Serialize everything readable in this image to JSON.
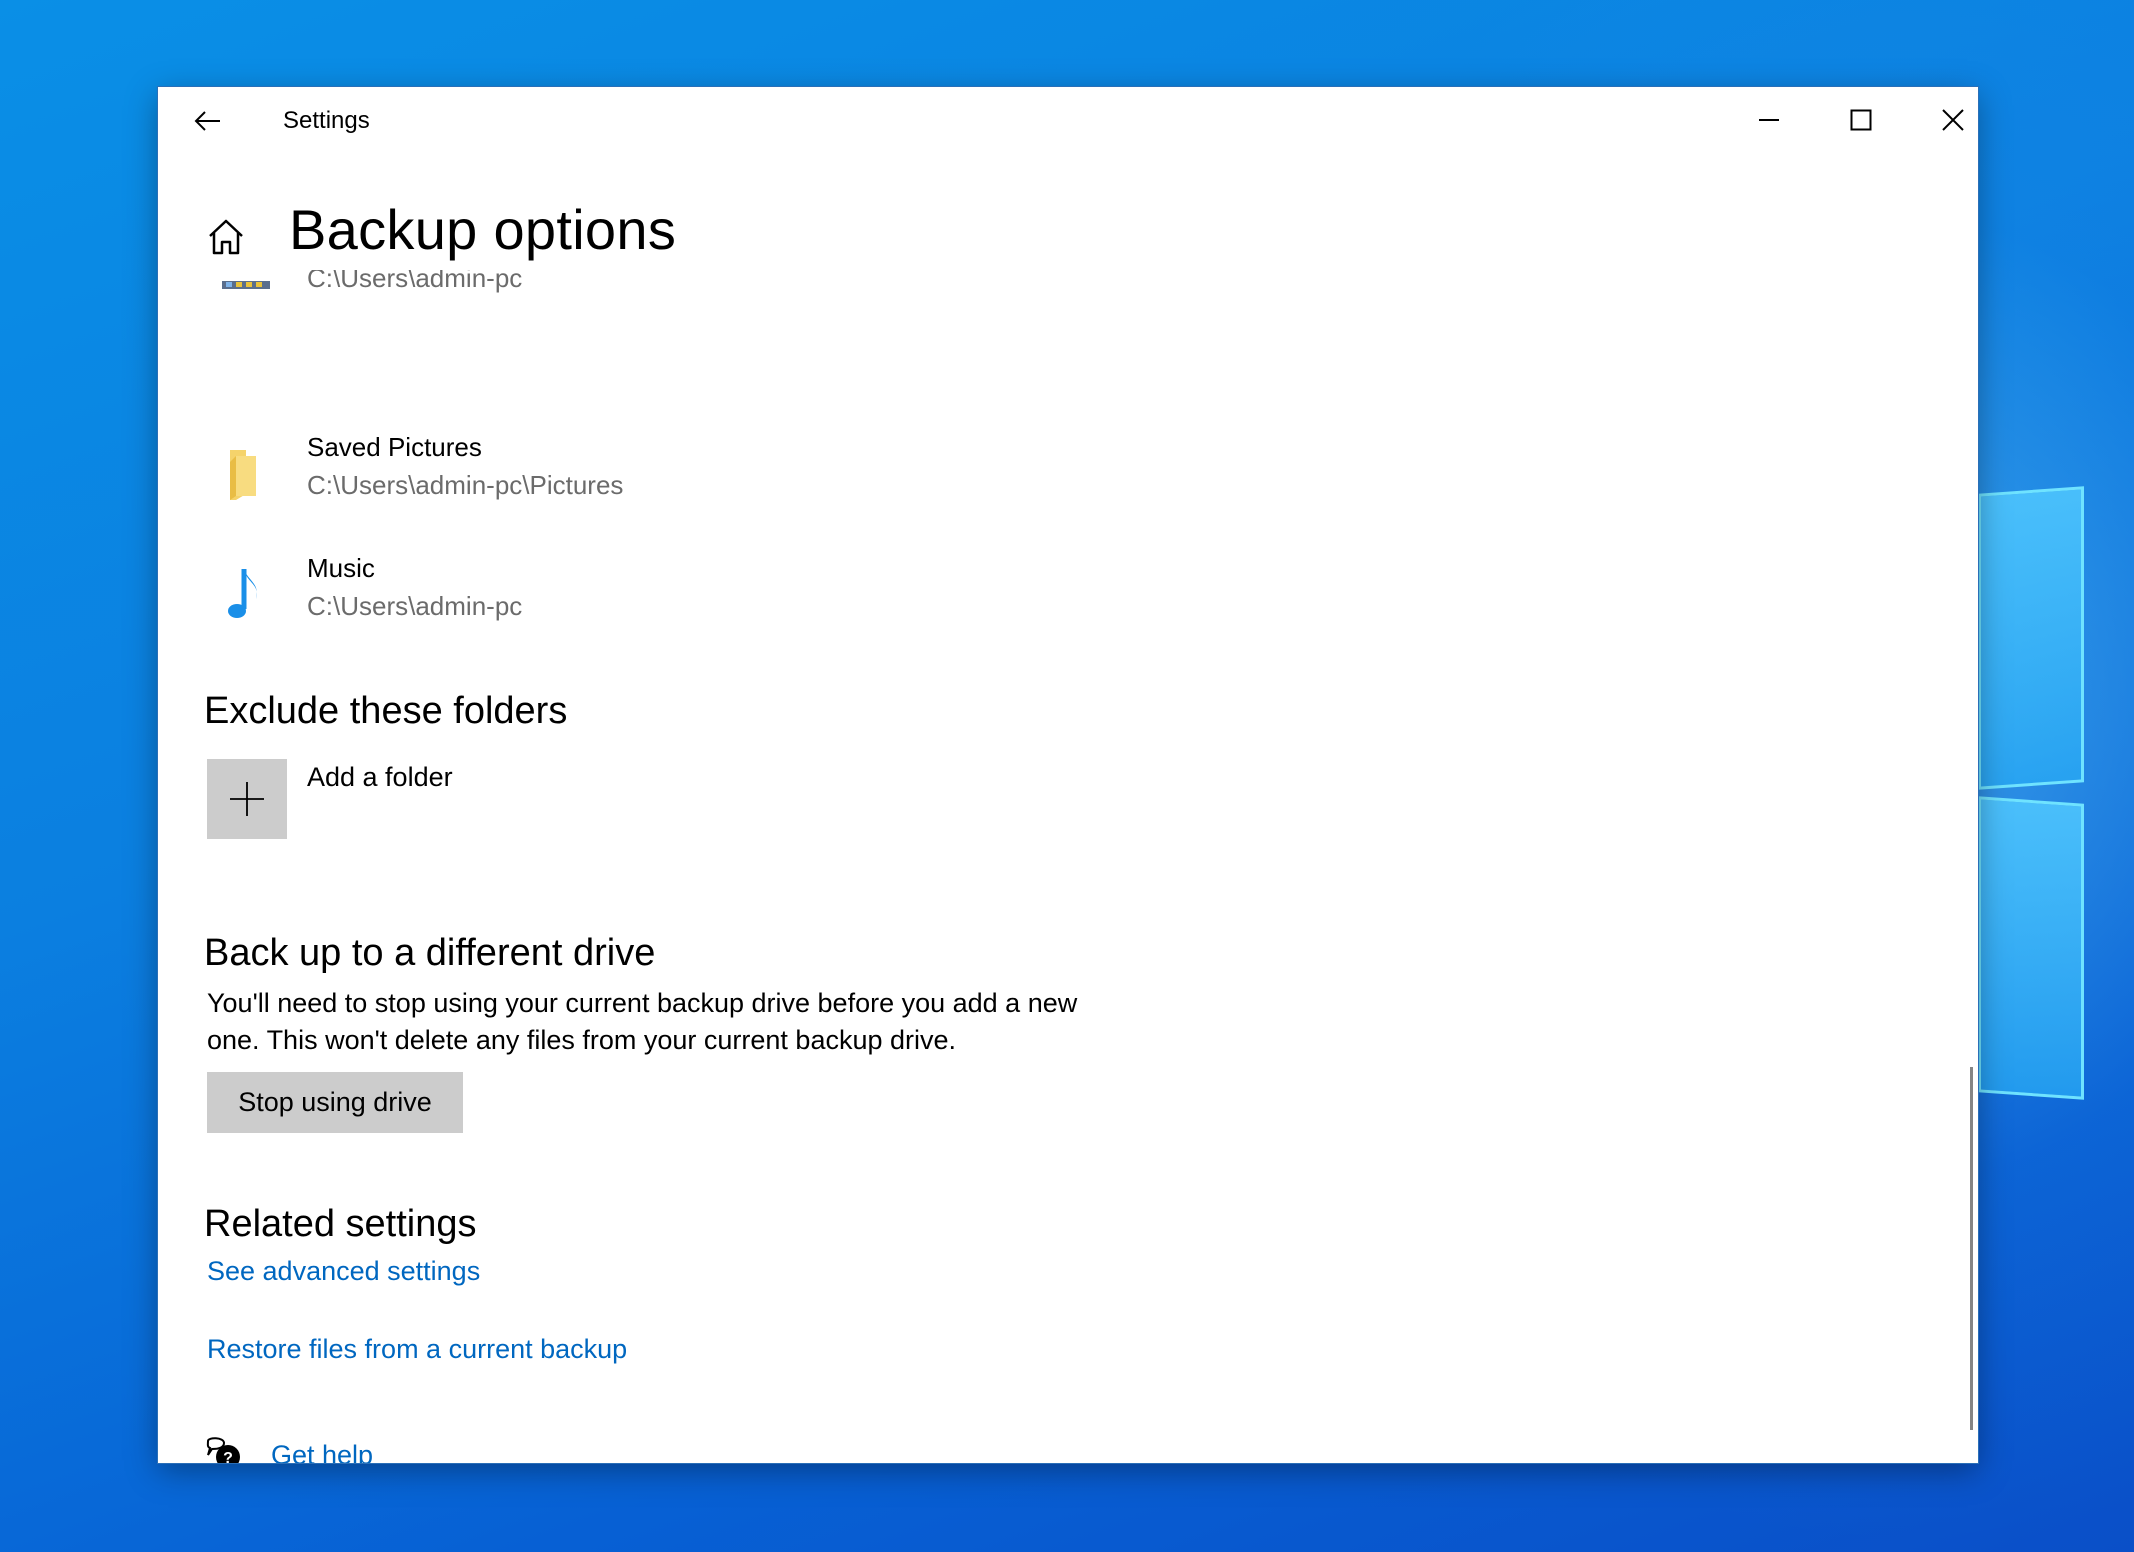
{
  "window": {
    "app_title": "Settings",
    "controls": {
      "back": "back-arrow-icon",
      "minimize": "minimize-icon",
      "maximize": "maximize-icon",
      "close": "close-icon"
    }
  },
  "header": {
    "home_icon": "home-icon",
    "title": "Backup options"
  },
  "folders": [
    {
      "name": "",
      "path": "C:\\Users\\admin-pc",
      "icon": "videos-icon",
      "clipped": true
    },
    {
      "name": "Saved Pictures",
      "path": "C:\\Users\\admin-pc\\Pictures",
      "icon": "folder-icon"
    },
    {
      "name": "Music",
      "path": "C:\\Users\\admin-pc",
      "icon": "music-note-icon"
    }
  ],
  "exclude": {
    "heading": "Exclude these folders",
    "add_label": "Add a folder",
    "add_icon": "plus-icon"
  },
  "different_drive": {
    "heading": "Back up to a different drive",
    "description": "You'll need to stop using your current backup drive before you add a new one. This won't delete any files from your current backup drive.",
    "button_label": "Stop using drive"
  },
  "related": {
    "heading": "Related settings",
    "links": [
      "See advanced settings",
      "Restore files from a current backup"
    ]
  },
  "help": {
    "label": "Get help",
    "icon": "help-chat-icon"
  },
  "colors": {
    "link": "#0067c0",
    "secondary_text": "#6b6b6b",
    "button_bg": "#cccccc",
    "music_icon": "#1a8fe8",
    "folder_icon": "#f5d36b"
  }
}
